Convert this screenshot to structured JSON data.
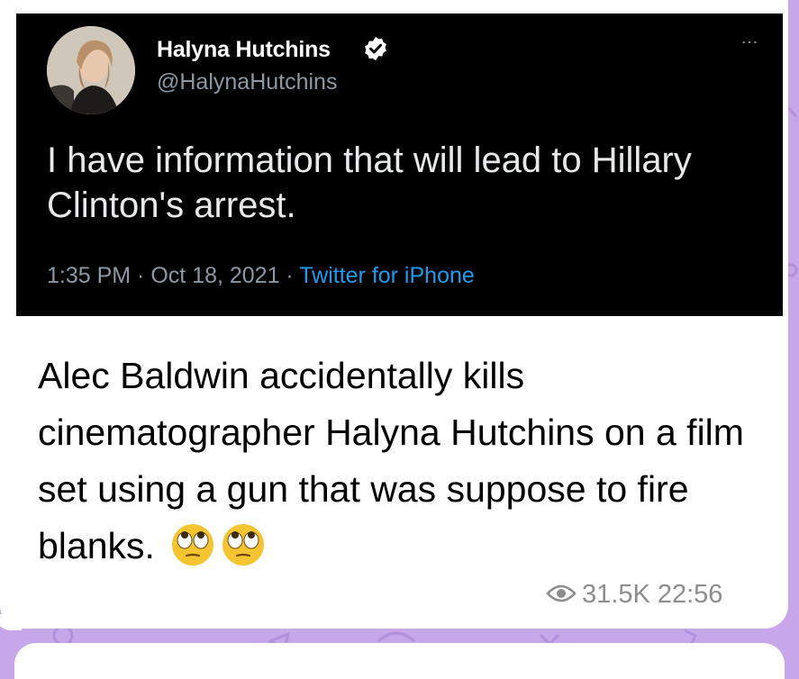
{
  "tweet": {
    "author_name": "Halyna Hutchins",
    "handle": "@HalynaHutchins",
    "more_icon": "…",
    "text": "I have information that will lead to Hillary Clinton's arrest.",
    "time": "1:35 PM",
    "date": "Oct 18, 2021",
    "source": "Twitter for iPhone",
    "separator": " · "
  },
  "message": {
    "text": "Alec Baldwin accidentally kills cinematographer Halyna Hutchins on a film set using a gun that was suppose to fire blanks.",
    "views": "31.5K",
    "time": "22:56"
  },
  "colors": {
    "chat_background": "#c7a6ea",
    "verified_badge": "#ffffff",
    "twitter_link": "#1d9bf0"
  },
  "icons": {
    "verified": "verified-badge-icon",
    "views": "eye-icon",
    "emoji": "face-with-rolling-eyes-emoji"
  }
}
